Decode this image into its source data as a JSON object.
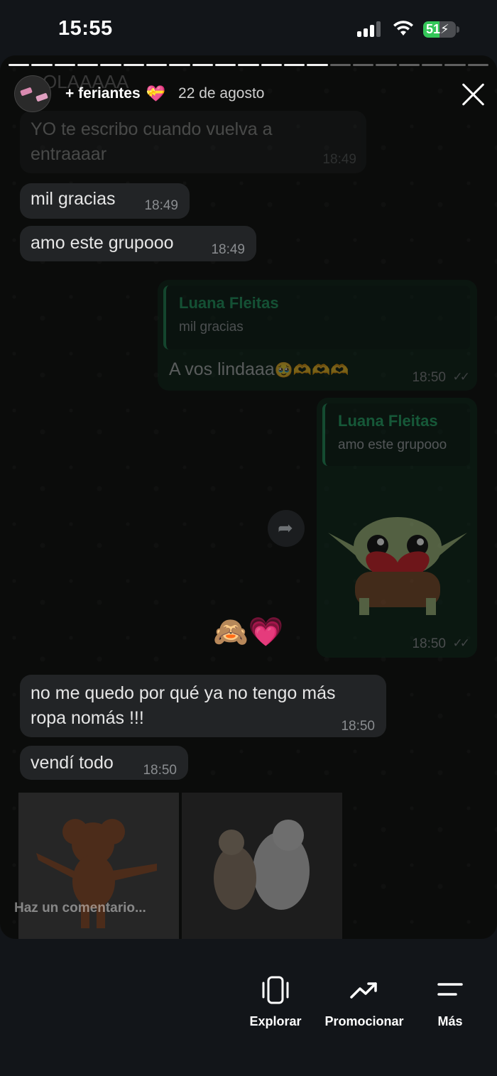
{
  "status_bar": {
    "time": "15:55",
    "battery": "51",
    "battery_level": 0.51
  },
  "story": {
    "author": "+ feriantes",
    "date": "22 de agosto",
    "progress": {
      "segments": 21,
      "completed": 14
    }
  },
  "chat": {
    "top_cut": "OLAAAAA",
    "messages": [
      {
        "text_line1": "YO te escribo cuando vuelva a",
        "text_line2": "entraaaar",
        "time": "18:49"
      },
      {
        "text": "mil gracias",
        "time": "18:49"
      },
      {
        "text": "amo este grupooo",
        "time": "18:49"
      },
      {
        "quote_name": "Luana Fleitas",
        "quote_text": "mil gracias",
        "text": "A vos lindaaa",
        "emoji": "🥹🫶🫶🫶",
        "time": "18:50"
      },
      {
        "quote_name": "Luana Fleitas",
        "quote_text": "amo este grupooo",
        "time": "18:50"
      },
      {
        "emoji": "🙈💗"
      },
      {
        "text_line1": "no me quedo por qué ya no tengo más",
        "text_line2": "ropa nomás !!!",
        "time": "18:50"
      },
      {
        "text": "vendí todo",
        "time": "18:50"
      }
    ]
  },
  "comment_placeholder": "Haz un comentario...",
  "bottom_actions": [
    {
      "label": "Explorar",
      "icon": "phone-vibrate-icon"
    },
    {
      "label": "Promocionar",
      "icon": "trending-up-icon"
    },
    {
      "label": "Más",
      "icon": "menu-lines-icon"
    }
  ],
  "colors": {
    "outgoing_bubble": "#0c2418",
    "incoming_bubble": "#222426",
    "quote_name": "#21a366",
    "battery": "#34c759"
  }
}
